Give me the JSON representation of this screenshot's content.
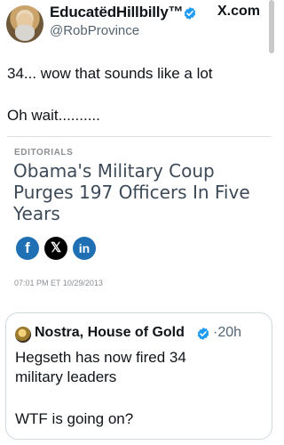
{
  "header": {
    "display_name": "EducatëdHillbilly™",
    "handle": "@RobProvince",
    "site_label": "X.com"
  },
  "tweet": {
    "line1": "34... wow that sounds like a lot",
    "line2": "Oh wait.........."
  },
  "article": {
    "section": "EDITORIALS",
    "headline": "Obama's Military Coup Purges 197 Officers In Five Years",
    "share_icons": [
      "facebook-icon",
      "x-icon",
      "linkedin-icon"
    ],
    "share_glyphs": {
      "facebook": "f",
      "x": "𝕏",
      "linkedin": "in"
    },
    "timestamp": "07:01 PM ET 10/29/2013"
  },
  "quote": {
    "name": "Nostra, House of Gold",
    "time": "·20h",
    "line1": "Hegseth has now fired 34",
    "line2": "military leaders",
    "line3": "WTF is going on?"
  },
  "colors": {
    "verified_blue": "#1d9bf0",
    "share_blue": "#1f6fb5",
    "headline_gray": "#3d4a57"
  }
}
